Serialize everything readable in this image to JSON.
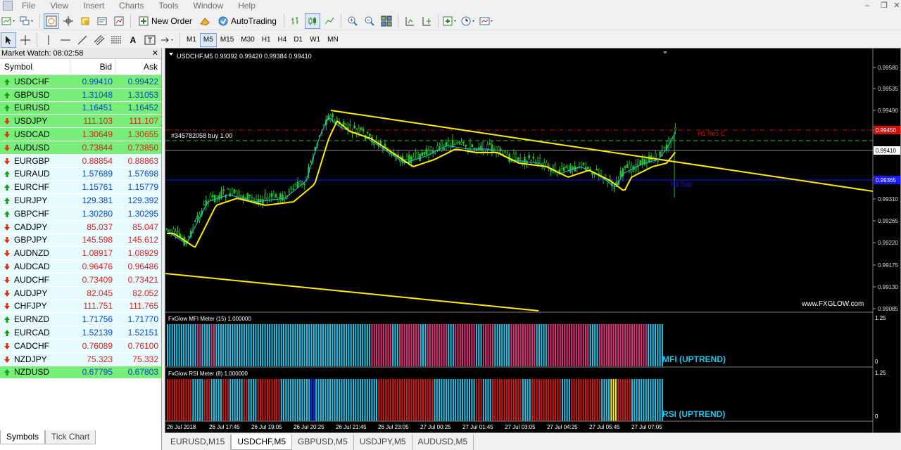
{
  "menu": [
    "File",
    "View",
    "Insert",
    "Charts",
    "Tools",
    "Window",
    "Help"
  ],
  "toolbar": {
    "new_order": "New Order",
    "auto_trading": "AutoTrading",
    "timeframes": [
      "M1",
      "M5",
      "M15",
      "M30",
      "H1",
      "H4",
      "D1",
      "W1",
      "MN"
    ],
    "active_timeframe": "M5"
  },
  "market_watch": {
    "title": "Market Watch: 08:02:58",
    "columns": [
      "Symbol",
      "Bid",
      "Ask"
    ],
    "rows": [
      {
        "symbol": "USDCHF",
        "bid": "0.99410",
        "ask": "0.99422",
        "bg": "green",
        "dir": "up"
      },
      {
        "symbol": "GBPUSD",
        "bid": "1.31048",
        "ask": "1.31053",
        "bg": "green",
        "dir": "up"
      },
      {
        "symbol": "EURUSD",
        "bid": "1.16451",
        "ask": "1.16452",
        "bg": "green",
        "dir": "up"
      },
      {
        "symbol": "USDJPY",
        "bid": "111.103",
        "ask": "111.107",
        "bg": "green",
        "dir": "dn"
      },
      {
        "symbol": "USDCAD",
        "bid": "1.30649",
        "ask": "1.30655",
        "bg": "green",
        "dir": "dn"
      },
      {
        "symbol": "AUDUSD",
        "bid": "0.73844",
        "ask": "0.73850",
        "bg": "green",
        "dir": "dn"
      },
      {
        "symbol": "EURGBP",
        "bid": "0.88854",
        "ask": "0.88863",
        "bg": "light",
        "dir": "dn"
      },
      {
        "symbol": "EURAUD",
        "bid": "1.57689",
        "ask": "1.57698",
        "bg": "light",
        "dir": "up"
      },
      {
        "symbol": "EURCHF",
        "bid": "1.15761",
        "ask": "1.15779",
        "bg": "light",
        "dir": "up"
      },
      {
        "symbol": "EURJPY",
        "bid": "129.381",
        "ask": "129.392",
        "bg": "light",
        "dir": "up"
      },
      {
        "symbol": "GBPCHF",
        "bid": "1.30280",
        "ask": "1.30295",
        "bg": "light",
        "dir": "up"
      },
      {
        "symbol": "CADJPY",
        "bid": "85.037",
        "ask": "85.047",
        "bg": "light",
        "dir": "dn"
      },
      {
        "symbol": "GBPJPY",
        "bid": "145.598",
        "ask": "145.612",
        "bg": "light",
        "dir": "dn"
      },
      {
        "symbol": "AUDNZD",
        "bid": "1.08917",
        "ask": "1.08929",
        "bg": "light",
        "dir": "dn"
      },
      {
        "symbol": "AUDCAD",
        "bid": "0.96476",
        "ask": "0.96486",
        "bg": "light",
        "dir": "dn"
      },
      {
        "symbol": "AUDCHF",
        "bid": "0.73409",
        "ask": "0.73421",
        "bg": "light",
        "dir": "dn"
      },
      {
        "symbol": "AUDJPY",
        "bid": "82.045",
        "ask": "82.052",
        "bg": "light",
        "dir": "dn"
      },
      {
        "symbol": "CHFJPY",
        "bid": "111.751",
        "ask": "111.765",
        "bg": "light",
        "dir": "dn"
      },
      {
        "symbol": "EURNZD",
        "bid": "1.71756",
        "ask": "1.71770",
        "bg": "light",
        "dir": "up"
      },
      {
        "symbol": "EURCAD",
        "bid": "1.52139",
        "ask": "1.52151",
        "bg": "light",
        "dir": "up"
      },
      {
        "symbol": "CADCHF",
        "bid": "0.76089",
        "ask": "0.76100",
        "bg": "light",
        "dir": "dn"
      },
      {
        "symbol": "NZDJPY",
        "bid": "75.323",
        "ask": "75.332",
        "bg": "light",
        "dir": "dn"
      },
      {
        "symbol": "NZDUSD",
        "bid": "0.67795",
        "ask": "0.67803",
        "bg": "green",
        "dir": "up"
      }
    ],
    "tabs": [
      "Symbols",
      "Tick Chart"
    ],
    "active_tab": "Symbols"
  },
  "chart": {
    "header": "USDCHF,M5  0.99392 0.99420 0.99384 0.99410",
    "order_label": "#345782058 buy 1.00",
    "res_label": "H1 Res C",
    "sup_label": "H1 Sup",
    "watermark": "www.FXGLOW.com",
    "price_levels": [
      "0.99580",
      "0.99535",
      "0.99490",
      "0.99450",
      "0.99410",
      "0.99365",
      "0.99310",
      "0.99265",
      "0.99220",
      "0.99175",
      "0.99130",
      "0.99085"
    ],
    "current_price": "0.99410",
    "res_price": "0.99450",
    "sup_price": "0.99365",
    "time_labels": [
      "26 Jul 2018",
      "26 Jul 17:45",
      "26 Jul 19:05",
      "26 Jul 20:25",
      "26 Jul 21:45",
      "26 Jul 23:05",
      "27 Jul 00:25",
      "27 Jul 01:45",
      "27 Jul 03:05",
      "27 Jul 04:25",
      "27 Jul 05:45",
      "27 Jul 07:05"
    ],
    "mfi": {
      "title": "FxGlow MFI Meter (15) 1.000000",
      "status": "MFI (UPTREND)",
      "scale_top": "1.25",
      "scale_bottom": "0"
    },
    "rsi": {
      "title": "FxGlow RSI Meter (8) 1.000000",
      "status": "RSI (UPTREND)",
      "scale_top": "1.25",
      "scale_bottom": "0"
    },
    "colors": {
      "bull": "#22c02a",
      "bear": "#22c02a",
      "trend": "#ffee00",
      "res": "#d01010",
      "sup": "#1a1aff",
      "cyan": "#22c4e8",
      "pink": "#e0307a",
      "red": "#d01818"
    }
  },
  "chart_tabs": [
    "EURUSD,M15",
    "USDCHF,M5",
    "GBPUSD,M5",
    "USDJPY,M5",
    "AUDUSD,M5"
  ],
  "active_chart_tab": "USDCHF,M5"
}
